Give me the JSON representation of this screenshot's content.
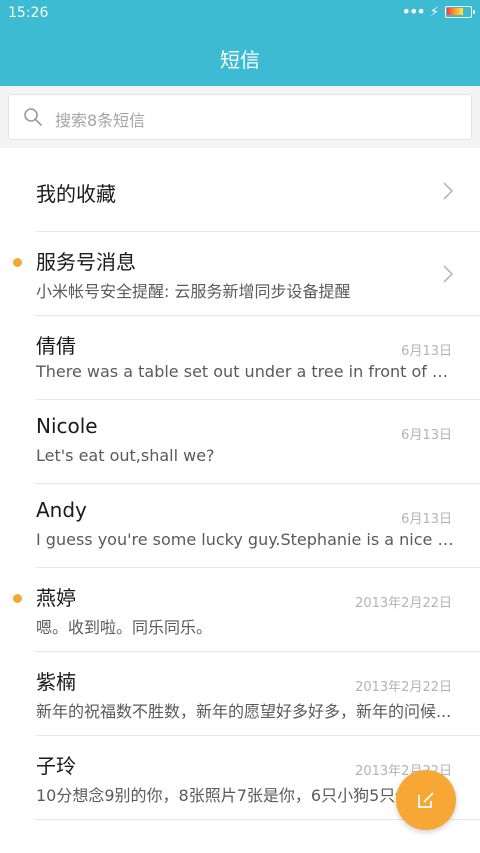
{
  "status_bar": {
    "time": "15:26"
  },
  "header": {
    "title": "短信"
  },
  "search": {
    "placeholder": "搜索8条短信"
  },
  "favorites": {
    "label": "我的收藏"
  },
  "service": {
    "name": "服务号消息",
    "preview": "小米帐号安全提醒: 云服务新增同步设备提醒",
    "unread": true
  },
  "threads": [
    {
      "name": "倩倩",
      "date": "6月13日",
      "preview": "There was a table set out under a tree in front of the ho...",
      "unread": false
    },
    {
      "name": "Nicole",
      "date": "6月13日",
      "preview": "Let's eat out,shall we?",
      "unread": false
    },
    {
      "name": "Andy",
      "date": "6月13日",
      "preview": "I guess you're some lucky guy.Stephanie is a nice girl.",
      "unread": false
    },
    {
      "name": "燕婷",
      "date": "2013年2月22日",
      "preview": "嗯。收到啦。同乐同乐。",
      "unread": true
    },
    {
      "name": "紫楠",
      "date": "2013年2月22日",
      "preview": "新年的祝福数不胜数，新年的愿望好多好多，新年的问候...",
      "unread": false
    },
    {
      "name": "子玲",
      "date": "2013年2月22日",
      "preview": "10分想念9别的你，8张照片7张是你，6只小狗5只像你...",
      "unread": false
    }
  ],
  "colors": {
    "primary": "#3dbbd3",
    "accent": "#f7a834"
  },
  "icons": {
    "search": "search-icon",
    "chevron": "chevron-right-icon",
    "compose": "compose-icon"
  }
}
